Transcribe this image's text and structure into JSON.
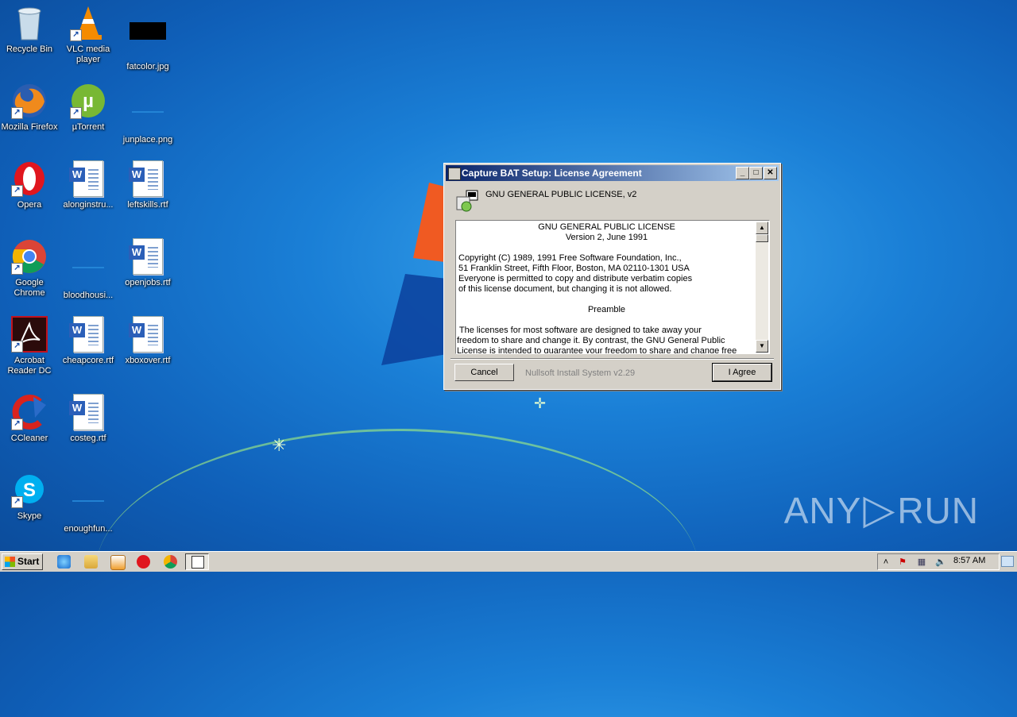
{
  "desktop": {
    "icons": [
      {
        "label": "Recycle Bin"
      },
      {
        "label": "VLC media player"
      },
      {
        "label": "fatcolor.jpg"
      },
      {
        "label": "Mozilla Firefox"
      },
      {
        "label": "µTorrent"
      },
      {
        "label": "junplace.png"
      },
      {
        "label": "Opera"
      },
      {
        "label": "alonginstru..."
      },
      {
        "label": "leftskills.rtf"
      },
      {
        "label": "Google Chrome"
      },
      {
        "label": "bloodhousi..."
      },
      {
        "label": "openjobs.rtf"
      },
      {
        "label": "Acrobat Reader DC"
      },
      {
        "label": "cheapcore.rtf"
      },
      {
        "label": "xboxover.rtf"
      },
      {
        "label": "CCleaner"
      },
      {
        "label": "costeg.rtf"
      },
      {
        "label": "Skype"
      },
      {
        "label": "enoughfun..."
      }
    ]
  },
  "dialog": {
    "title": "Capture BAT Setup: License Agreement",
    "header": "GNU GENERAL PUBLIC LICENSE, v2",
    "license_lines": [
      "GNU GENERAL PUBLIC LICENSE",
      "Version 2, June 1991",
      "Copyright (C) 1989, 1991 Free Software Foundation, Inc.,",
      "51 Franklin Street, Fifth Floor, Boston, MA 02110-1301 USA",
      "Everyone is permitted to copy and distribute verbatim copies",
      "of this license document, but changing it is not allowed.",
      "Preamble",
      " The licenses for most software are designed to take away your",
      "freedom to share and change it.  By contrast, the GNU General Public",
      "License is intended to guarantee your freedom to share and change free"
    ],
    "cancel_label": "Cancel",
    "branding": "Nullsoft Install System v2.29",
    "agree_label": "I Agree",
    "buttons": {
      "minimize": "_",
      "maximize": "□",
      "close": "✕"
    }
  },
  "taskbar": {
    "start_label": "Start",
    "clock": "8:57 AM"
  },
  "watermark": {
    "left": "ANY",
    "right": "RUN"
  },
  "colors": {
    "titlebar_start": "#0a246a",
    "titlebar_end": "#a6caf0",
    "dialog_bg": "#d4d0c8"
  }
}
